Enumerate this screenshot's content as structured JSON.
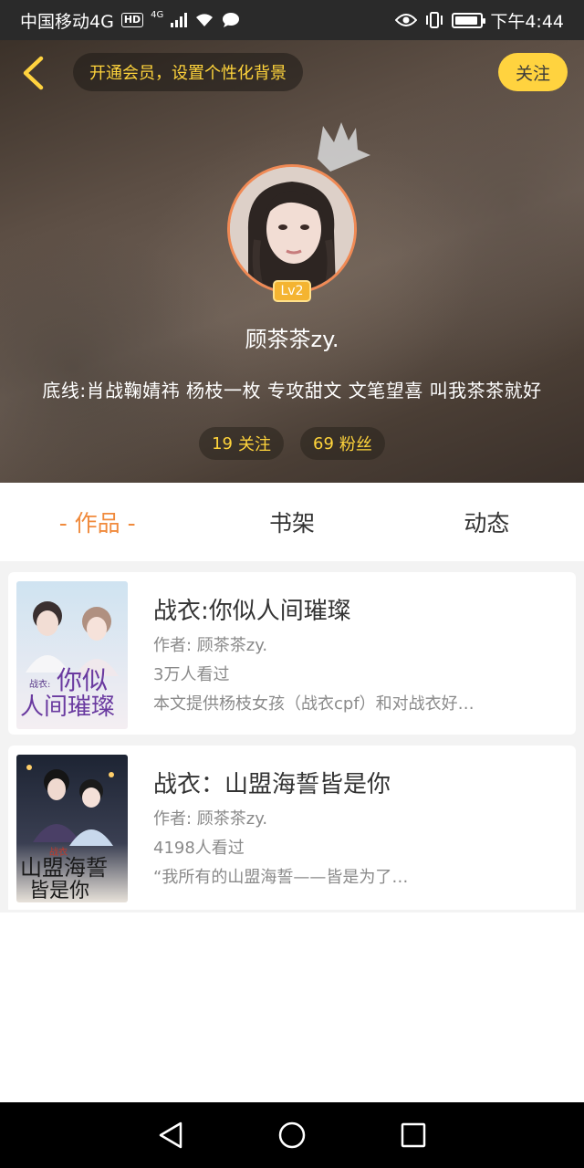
{
  "status_bar": {
    "carrier": "中国移动4G",
    "hd_badge": "HD",
    "network_small": "4G",
    "time": "下午4:44",
    "battery_level": 0.9
  },
  "header": {
    "vip_prompt": "开通会员，设置个性化背景",
    "follow_label": "关注"
  },
  "profile": {
    "level": "Lv2",
    "username": "顾茶茶zy.",
    "bio": "底线:肖战鞠婧祎 杨枝一枚 专攻甜文 文笔望喜 叫我茶茶就好",
    "following_count": "19",
    "following_label": "关注",
    "fans_count": "69",
    "fans_label": "粉丝"
  },
  "tabs": [
    {
      "label": "- 作品 -",
      "active": true
    },
    {
      "label": "书架",
      "active": false
    },
    {
      "label": "动态",
      "active": false
    }
  ],
  "books": [
    {
      "title": "战衣:你似人间璀璨",
      "author": "作者: 顾茶茶zy.",
      "views": "3万人看过",
      "desc": "本文提供杨枝女孩（战衣cpf）和对战衣好…",
      "cover_line1": "你似",
      "cover_line2": "人间璀璨",
      "cover_prefix": "战衣:"
    },
    {
      "title": "战衣：山盟海誓皆是你",
      "author": "作者: 顾茶茶zy.",
      "views": "4198人看过",
      "desc": "“我所有的山盟海誓——皆是为了…",
      "cover_line1": "山盟海誓",
      "cover_line2": "皆是你",
      "cover_prefix": "战衣"
    }
  ],
  "colors": {
    "accent_orange": "#f08a3c",
    "accent_yellow": "#ffd33f",
    "status_bar": "#2a2a2a"
  }
}
